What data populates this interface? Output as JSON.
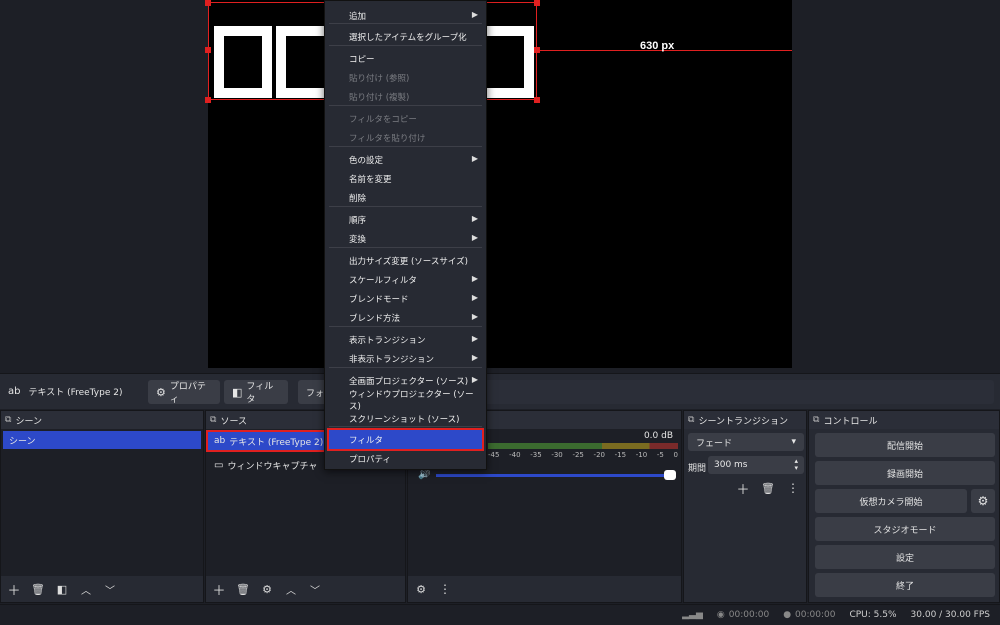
{
  "preview": {
    "dimension_label": "630 px"
  },
  "context_bar": {
    "source_name": "テキスト (FreeType 2)",
    "properties_label": "プロパティ",
    "filters_label": "フィルタ",
    "font_label": "フォ"
  },
  "scenes": {
    "title": "シーン",
    "items": [
      "シーン"
    ]
  },
  "sources": {
    "title": "ソース",
    "items": [
      {
        "label": "テキスト (FreeType 2)",
        "icon": "text-icon"
      },
      {
        "label": "ウィンドウキャプチャ",
        "icon": "window-icon"
      }
    ]
  },
  "audio_mixer": {
    "db_value": "0.0 dB",
    "scale": [
      "-45",
      "-40",
      "-35",
      "-30",
      "-25",
      "-20",
      "-15",
      "-10",
      "-5",
      "0"
    ],
    "volume": 1.0
  },
  "transitions": {
    "title": "シーントランジション",
    "selected": "フェード",
    "duration_label": "期間",
    "duration_value": "300 ms"
  },
  "controls": {
    "title": "コントロール",
    "start_streaming": "配信開始",
    "start_recording": "録画開始",
    "start_virtualcam": "仮想カメラ開始",
    "studio_mode": "スタジオモード",
    "settings": "設定",
    "exit": "終了"
  },
  "status_bar": {
    "stream_time": "00:00:00",
    "record_time": "00:00:00",
    "cpu": "CPU: 5.5%",
    "fps": "30.00 / 30.00 FPS"
  },
  "context_menu": {
    "items": [
      {
        "label": "追加",
        "submenu": true
      },
      {
        "label": "選択したアイテムをグループ化"
      },
      {
        "label": "コピー"
      },
      {
        "label": "貼り付け (参照)",
        "disabled": true
      },
      {
        "label": "貼り付け (複製)",
        "disabled": true
      },
      {
        "label": "フィルタをコピー",
        "disabled": true
      },
      {
        "label": "フィルタを貼り付け",
        "disabled": true
      },
      {
        "label": "色の設定",
        "submenu": true
      },
      {
        "label": "名前を変更"
      },
      {
        "label": "削除"
      },
      {
        "label": "順序",
        "submenu": true
      },
      {
        "label": "変換",
        "submenu": true
      },
      {
        "label": "出力サイズ変更 (ソースサイズ)"
      },
      {
        "label": "スケールフィルタ",
        "submenu": true
      },
      {
        "label": "ブレンドモード",
        "submenu": true
      },
      {
        "label": "ブレンド方法",
        "submenu": true
      },
      {
        "label": "表示トランジション",
        "submenu": true
      },
      {
        "label": "非表示トランジション",
        "submenu": true
      },
      {
        "label": "全画面プロジェクター (ソース)",
        "submenu": true
      },
      {
        "label": "ウィンドウプロジェクター (ソース)"
      },
      {
        "label": "スクリーンショット (ソース)"
      },
      {
        "label": "フィルタ",
        "highlighted": true
      },
      {
        "label": "プロパティ"
      }
    ]
  },
  "colors": {
    "accent": "#2d49c9",
    "highlight_outline": "#e02020",
    "background": "#1d1f26"
  }
}
